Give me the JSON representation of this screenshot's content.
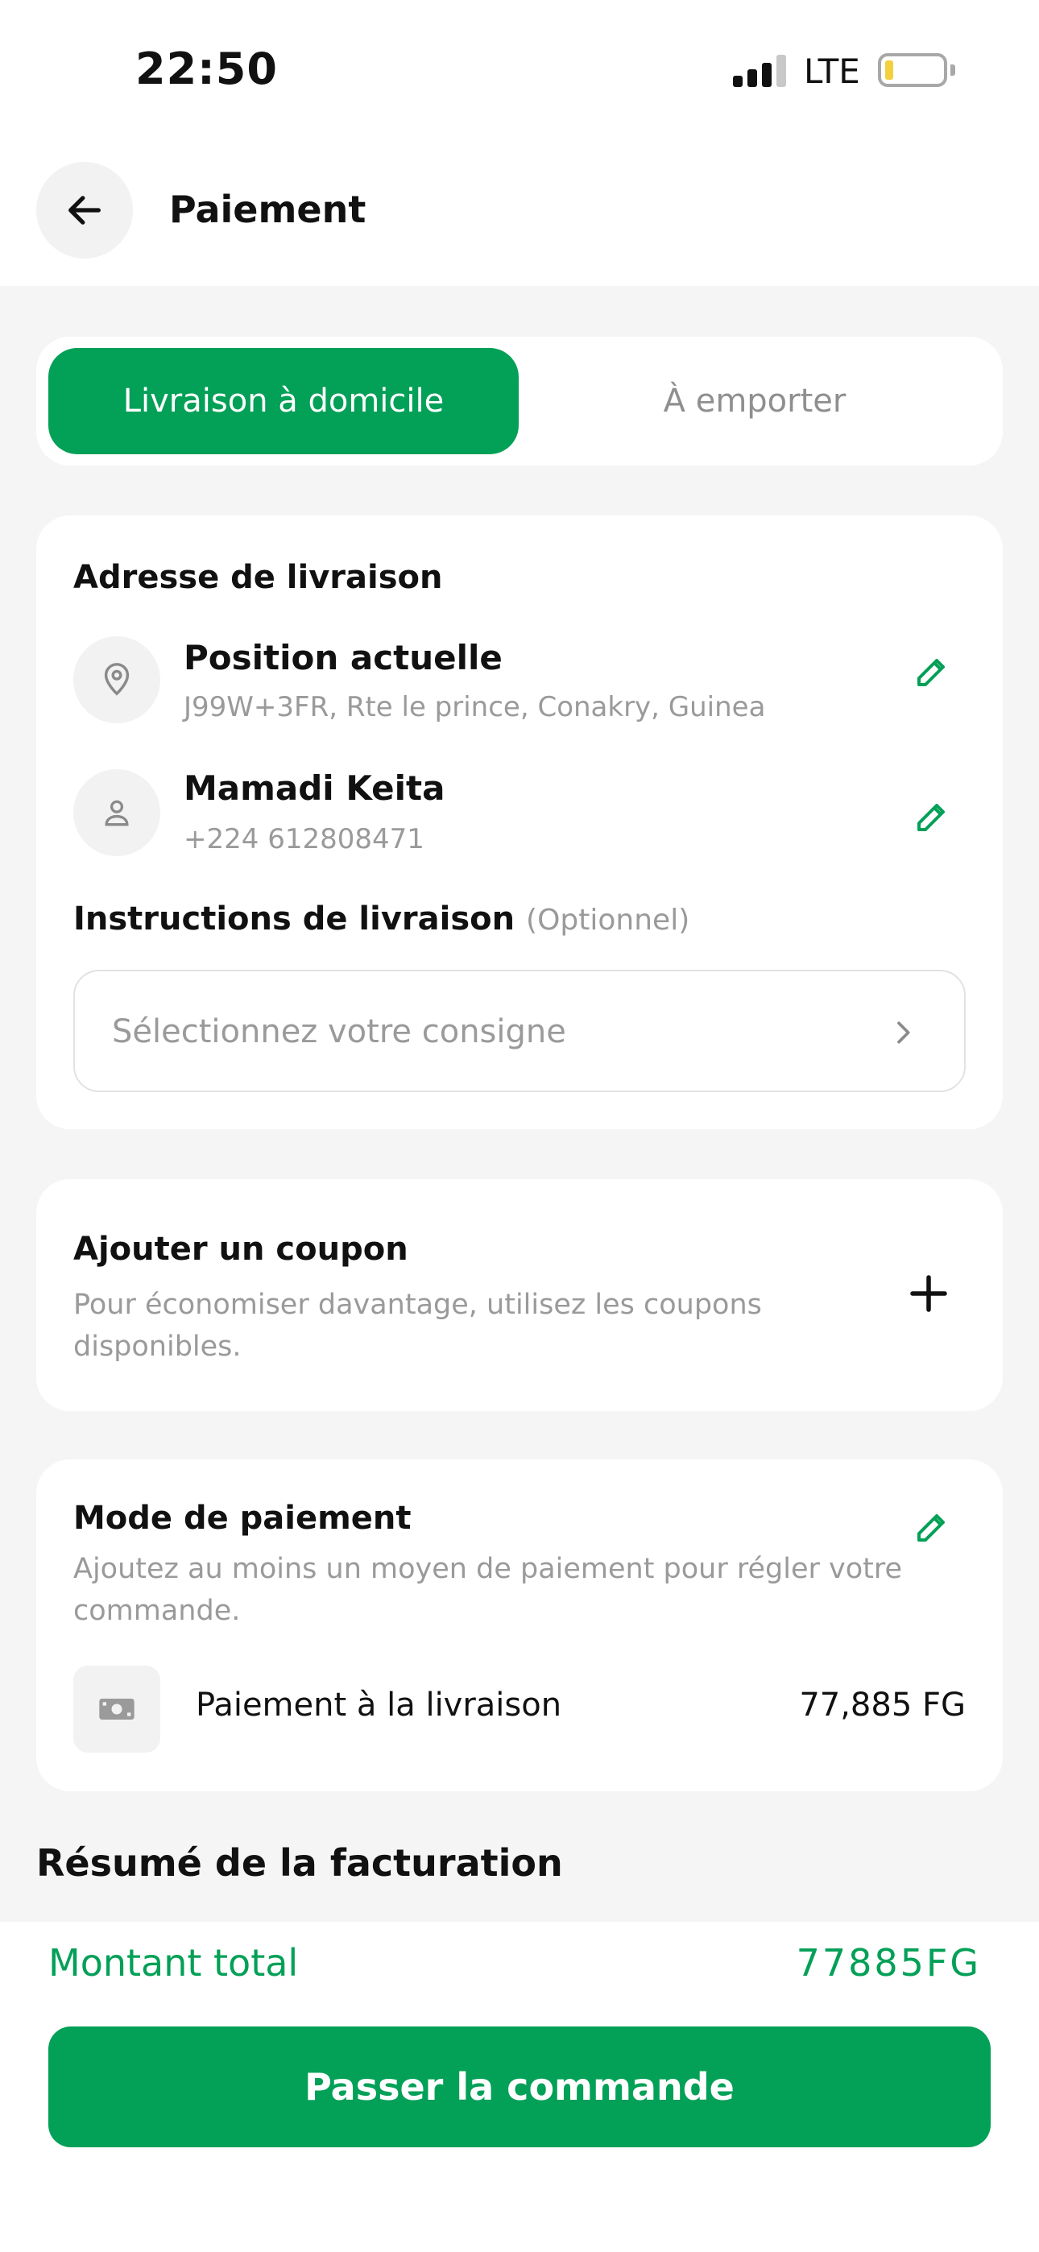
{
  "status_bar": {
    "time": "22:50",
    "network": "LTE"
  },
  "header": {
    "title": "Paiement",
    "back_icon": "arrow-left-icon"
  },
  "tabs": [
    {
      "label": "Livraison à domicile",
      "active": true
    },
    {
      "label": "À emporter",
      "active": false
    }
  ],
  "address": {
    "section_title": "Adresse de livraison",
    "location": {
      "title": "Position actuelle",
      "subtitle": "J99W+3FR, Rte le prince, Conakry, Guinea",
      "icon": "location-pin-icon"
    },
    "contact": {
      "name": "Mamadi Keita",
      "phone": "+224 612808471",
      "icon": "person-icon"
    },
    "instructions": {
      "label": "Instructions de livraison",
      "optional": "(Optionnel)",
      "placeholder": "Sélectionnez votre consigne"
    }
  },
  "coupon": {
    "title": "Ajouter un coupon",
    "description": "Pour économiser davantage, utilisez les coupons disponibles."
  },
  "payment": {
    "title": "Mode de paiement",
    "description": "Ajoutez au moins un moyen de paiement pour régler votre commande.",
    "method_label": "Paiement à la livraison",
    "method_amount": "77,885 FG",
    "method_icon": "cash-icon"
  },
  "summary": {
    "title": "Résumé de la facturation"
  },
  "footer": {
    "total_label": "Montant total",
    "total_value": "77885FG",
    "order_button": "Passer la commande"
  },
  "colors": {
    "accent": "#03a057",
    "muted_text": "#9a9a9a",
    "icon_bg": "#f2f2f2"
  }
}
